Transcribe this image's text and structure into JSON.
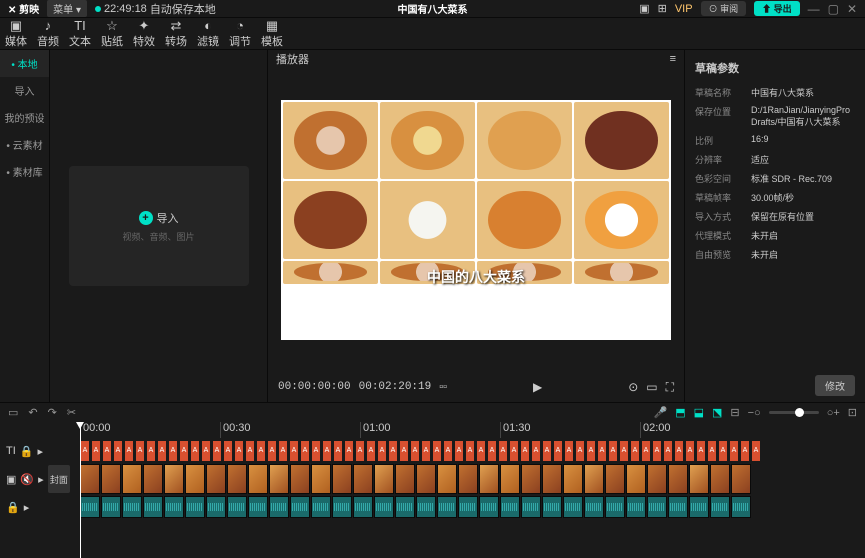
{
  "titlebar": {
    "logo": "✕ 剪映",
    "menu": "菜单 ▾",
    "autosave_time": "22:49:18",
    "autosave_text": "自动保存本地",
    "project_title": "中国有八大菜系",
    "vip": "VIP",
    "review": "⊙ 审阅",
    "export": "⬆ 导出"
  },
  "tools": [
    {
      "icon": "▣",
      "label": "媒体"
    },
    {
      "icon": "♪",
      "label": "音频"
    },
    {
      "icon": "TI",
      "label": "文本"
    },
    {
      "icon": "☆",
      "label": "贴纸"
    },
    {
      "icon": "✦",
      "label": "特效"
    },
    {
      "icon": "⇄",
      "label": "转场"
    },
    {
      "icon": "◐",
      "label": "滤镜"
    },
    {
      "icon": "◔",
      "label": "调节"
    },
    {
      "icon": "▦",
      "label": "模板"
    }
  ],
  "sidebar": {
    "items": [
      {
        "label": "• 本地",
        "active": true
      },
      {
        "label": "导入"
      },
      {
        "label": "我的预设"
      },
      {
        "label": "• 云素材"
      },
      {
        "label": "• 素材库"
      }
    ]
  },
  "import": {
    "label": "导入",
    "sub": "视频、音频、图片"
  },
  "preview": {
    "header": "播放器",
    "caption": "中国的八大菜系",
    "tc_current": "00:00:00:00",
    "tc_total": "00:02:20:19"
  },
  "props": {
    "title": "草稿参数",
    "rows": [
      {
        "k": "草稿名称",
        "v": "中国有八大菜系"
      },
      {
        "k": "保存位置",
        "v": "D:/1RanJian/JianyingPro Drafts/中国有八大菜系"
      },
      {
        "k": "比例",
        "v": "16:9"
      },
      {
        "k": "分辨率",
        "v": "适应"
      },
      {
        "k": "色彩空间",
        "v": "标准 SDR - Rec.709"
      },
      {
        "k": "草稿帧率",
        "v": "30.00帧/秒"
      },
      {
        "k": "导入方式",
        "v": "保留在原有位置"
      },
      {
        "k": "代理模式",
        "v": "未开启"
      },
      {
        "k": "自由预览",
        "v": "未开启"
      }
    ],
    "edit": "修改"
  },
  "ruler": [
    "00:00",
    "00:30",
    "01:00",
    "01:30",
    "02:00"
  ],
  "track_cover": "封面"
}
